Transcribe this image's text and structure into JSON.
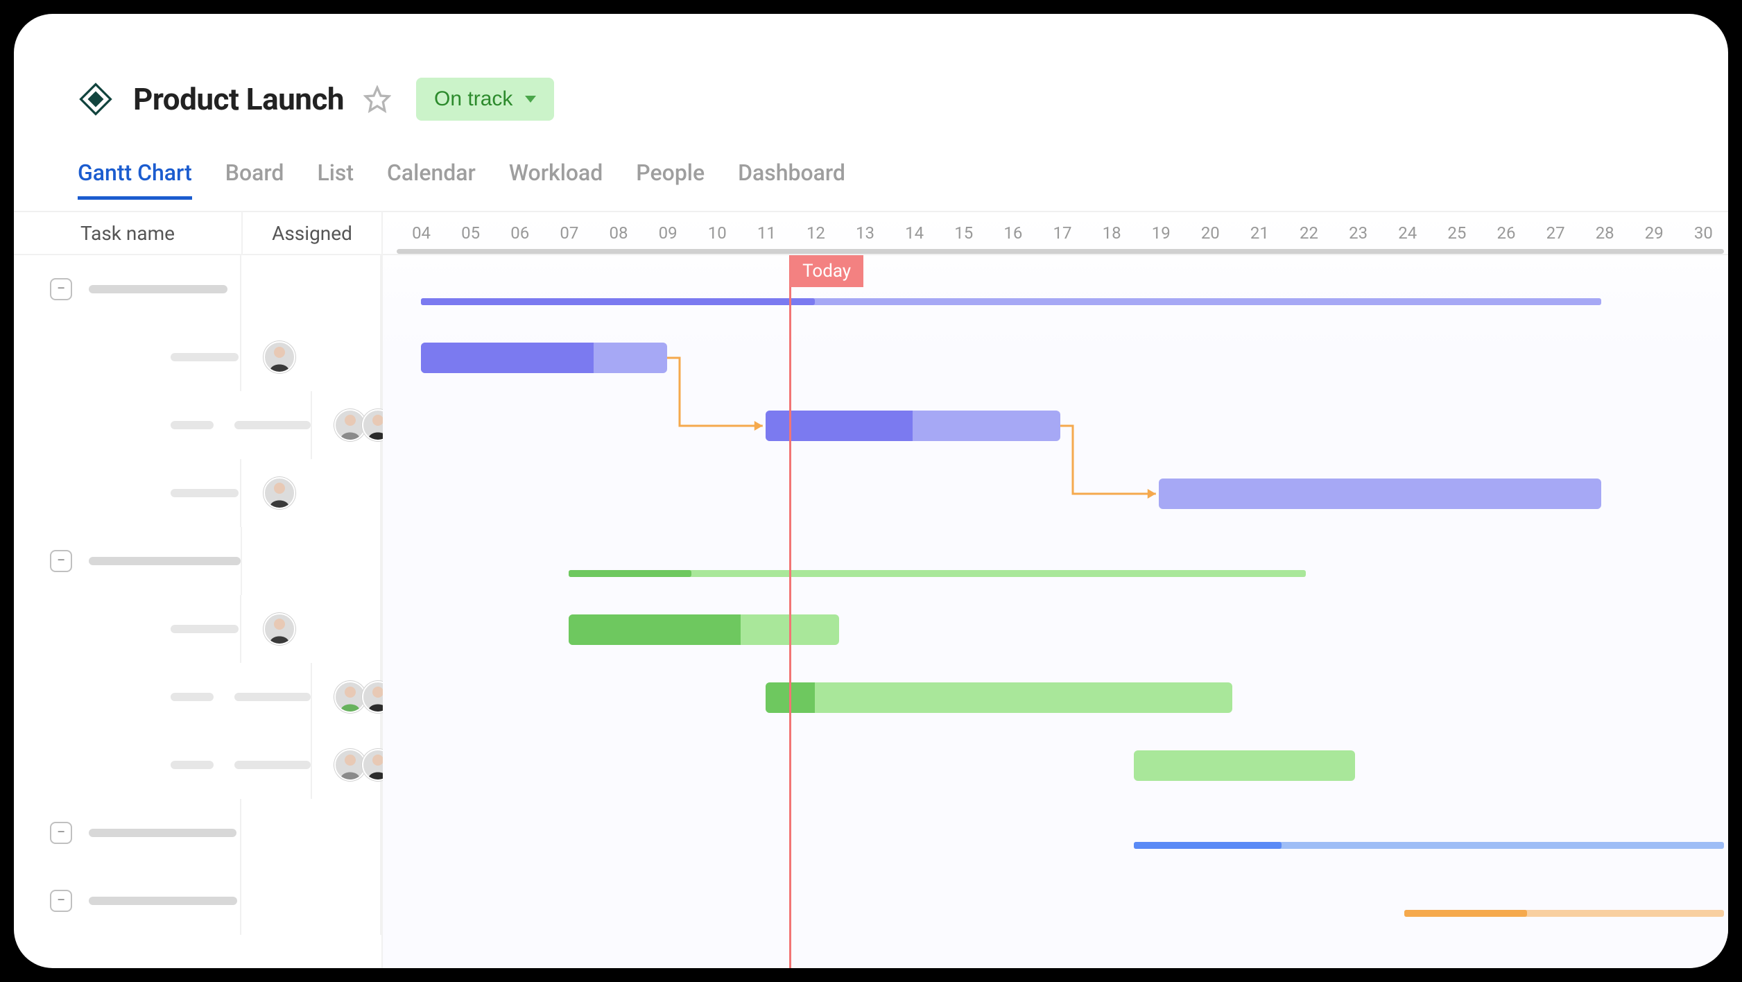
{
  "header": {
    "title": "Product Launch",
    "status_label": "On track"
  },
  "tabs": [
    "Gantt Chart",
    "Board",
    "List",
    "Calendar",
    "Workload",
    "People",
    "Dashboard"
  ],
  "active_tab": 0,
  "columns": {
    "task": "Task name",
    "assigned": "Assigned"
  },
  "dates": [
    "04",
    "05",
    "06",
    "07",
    "08",
    "09",
    "10",
    "11",
    "12",
    "13",
    "14",
    "15",
    "16",
    "17",
    "18",
    "19",
    "20",
    "21",
    "22",
    "23",
    "24",
    "25",
    "26",
    "27",
    "28",
    "29",
    "30"
  ],
  "today": {
    "label": "Today",
    "at": "12"
  },
  "colors": {
    "purple_solid": "#7b7af0",
    "purple_light": "#a6a8f5",
    "green_solid": "#6ec85f",
    "green_light": "#a9e79a",
    "blue_solid": "#5a8af6",
    "blue_light": "#9ebdf6",
    "orange_solid": "#f5a94d",
    "orange_light": "#f8cfa0",
    "dep": "#f5a94d"
  },
  "chart_data": {
    "type": "gantt",
    "x_unit": "day_of_month",
    "x_range": [
      4,
      30
    ],
    "today": 12,
    "groups": [
      {
        "color": "purple",
        "summary": {
          "start": 4,
          "end": 28,
          "progress_until": 12
        },
        "tasks": [
          {
            "start": 4,
            "end": 9,
            "progress_until": 7.5,
            "assignees": 1
          },
          {
            "start": 11,
            "end": 17,
            "progress_until": 14,
            "assignees": 2,
            "depends_on_prev": true
          },
          {
            "start": 19,
            "end": 28,
            "progress_until": 19,
            "assignees": 1,
            "depends_on_prev": true
          }
        ]
      },
      {
        "color": "green",
        "summary": {
          "start": 7,
          "end": 22,
          "progress_until": 9.5
        },
        "tasks": [
          {
            "start": 7,
            "end": 12.5,
            "progress_until": 10.5,
            "assignees": 1
          },
          {
            "start": 11,
            "end": 20.5,
            "progress_until": 12,
            "assignees": 2
          },
          {
            "start": 18.5,
            "end": 23,
            "progress_until": 18.5,
            "assignees": 2
          }
        ]
      },
      {
        "color": "blue",
        "summary": {
          "start": 18.5,
          "end": 30.5,
          "progress_until": 21.5
        },
        "tasks": []
      },
      {
        "color": "orange",
        "summary": {
          "start": 24,
          "end": 30.5,
          "progress_until": 26.5
        },
        "tasks": []
      }
    ]
  }
}
